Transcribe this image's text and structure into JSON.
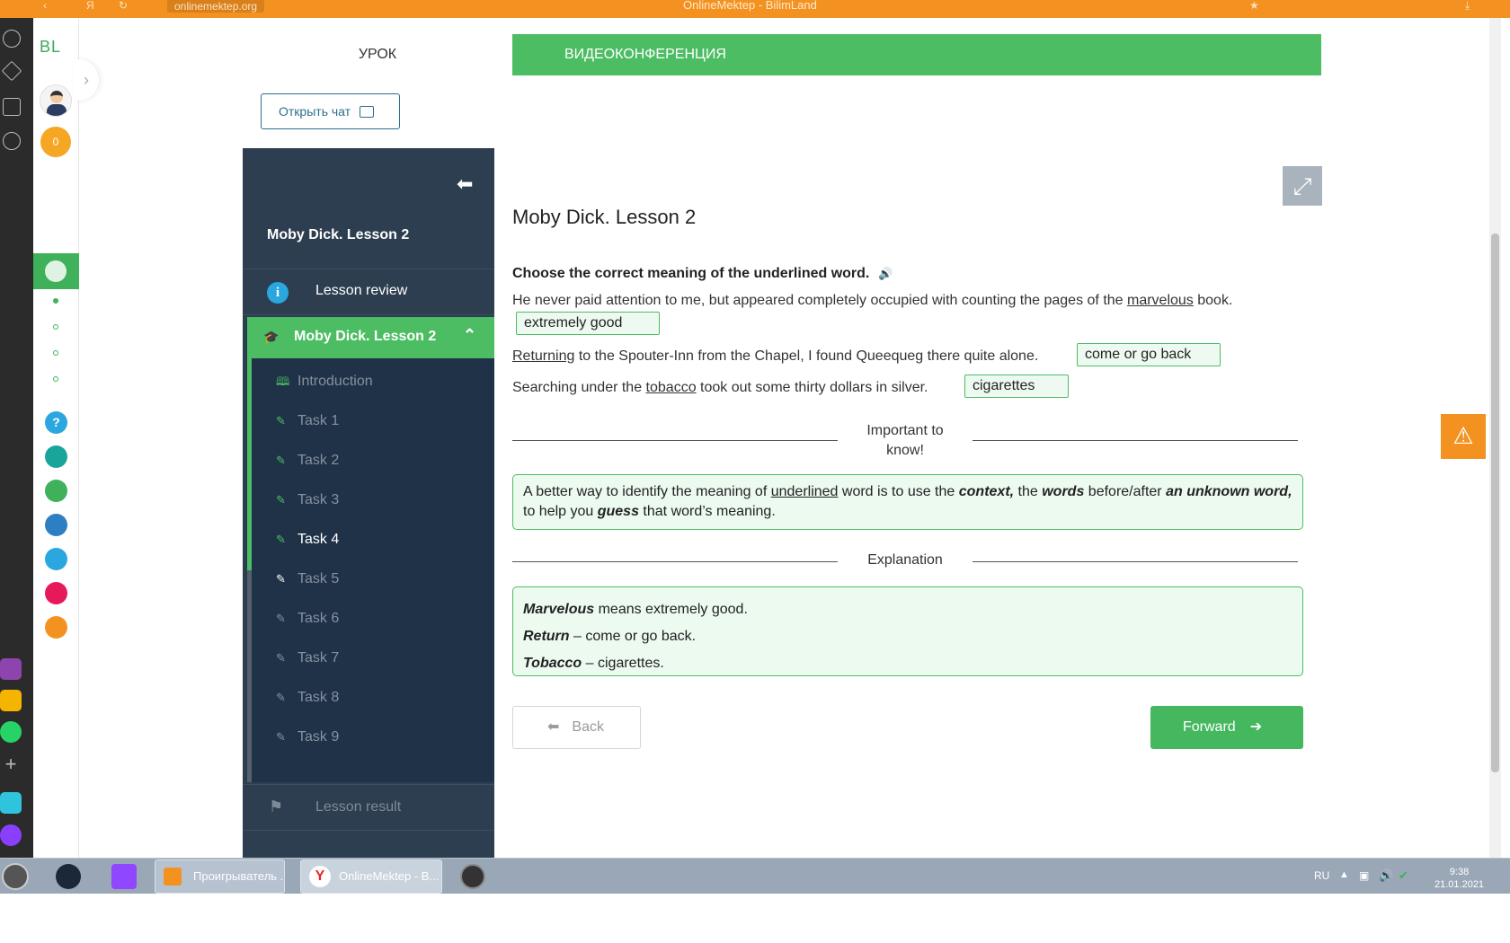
{
  "browser": {
    "url": "onlinemektep.org",
    "window_title": "OnlineMektep - BilimLand"
  },
  "site_sidebar": {
    "logo": "BL",
    "coins": "0"
  },
  "tabs": {
    "lesson": "УРОК",
    "video": "ВИДЕОКОНФЕРЕНЦИЯ"
  },
  "chat_button": "Открыть чат",
  "nav": {
    "title": "Moby Dick. Lesson 2",
    "review": "Lesson review",
    "current": "Moby Dick. Lesson 2",
    "items": [
      {
        "label": "Introduction",
        "icon": "book-icon"
      },
      {
        "label": "Task 1",
        "icon": "edit-icon"
      },
      {
        "label": "Task 2",
        "icon": "edit-icon"
      },
      {
        "label": "Task 3",
        "icon": "edit-icon"
      },
      {
        "label": "Task 4",
        "icon": "edit-icon"
      },
      {
        "label": "Task 5",
        "icon": "edit-icon"
      },
      {
        "label": "Task 6",
        "icon": "edit-icon"
      },
      {
        "label": "Task 7",
        "icon": "edit-icon"
      },
      {
        "label": "Task 8",
        "icon": "edit-icon"
      },
      {
        "label": "Task 9",
        "icon": "edit-icon"
      }
    ],
    "result": "Lesson result"
  },
  "content": {
    "title": "Moby Dick. Lesson 2",
    "instruction": "Choose the correct meaning of the underlined word.",
    "sentences": [
      {
        "before": "He never paid attention to me, but appeared completely occupied with counting the pages of the ",
        "word": "marvelous",
        "after": " book.",
        "answer": "extremely good"
      },
      {
        "before": "",
        "word": "Returning",
        "after": " to the Spouter-Inn from the Chapel, I found Queequeg there quite alone.",
        "answer": "come or go back"
      },
      {
        "before": "Searching under the ",
        "word": "tobacco",
        "after": " took out some thirty dollars in silver.",
        "answer": "cigarettes"
      }
    ],
    "important_label_1": "Important to",
    "important_label_2": "know!",
    "important_text": {
      "p1": "A better way to identify the meaning of ",
      "u1": "underlined",
      "p2": " word is to use the ",
      "b1": "context,",
      "p3": " the ",
      "b2": "words",
      "p4": " before/after ",
      "b3": "an unknown word,",
      "p5": " to help you ",
      "b4": "guess",
      "p6": " that word’s meaning."
    },
    "explanation_label": "Explanation",
    "explanations": [
      {
        "term": "Marvelous",
        "rest": " means extremely good."
      },
      {
        "term": "Return",
        "rest": " – come or go back."
      },
      {
        "term": "Tobacco",
        "rest": " – cigarettes."
      }
    ],
    "back": "Back",
    "forward": "Forward"
  },
  "taskbar": {
    "player": "Проигрыватель ...",
    "browser": "OnlineMektep - B...",
    "lang": "RU",
    "time": "9:38",
    "date": "21.01.2021"
  },
  "colors": {
    "green": "#4cbd63",
    "nav_dark": "#2d3e50",
    "orange": "#f39220"
  }
}
